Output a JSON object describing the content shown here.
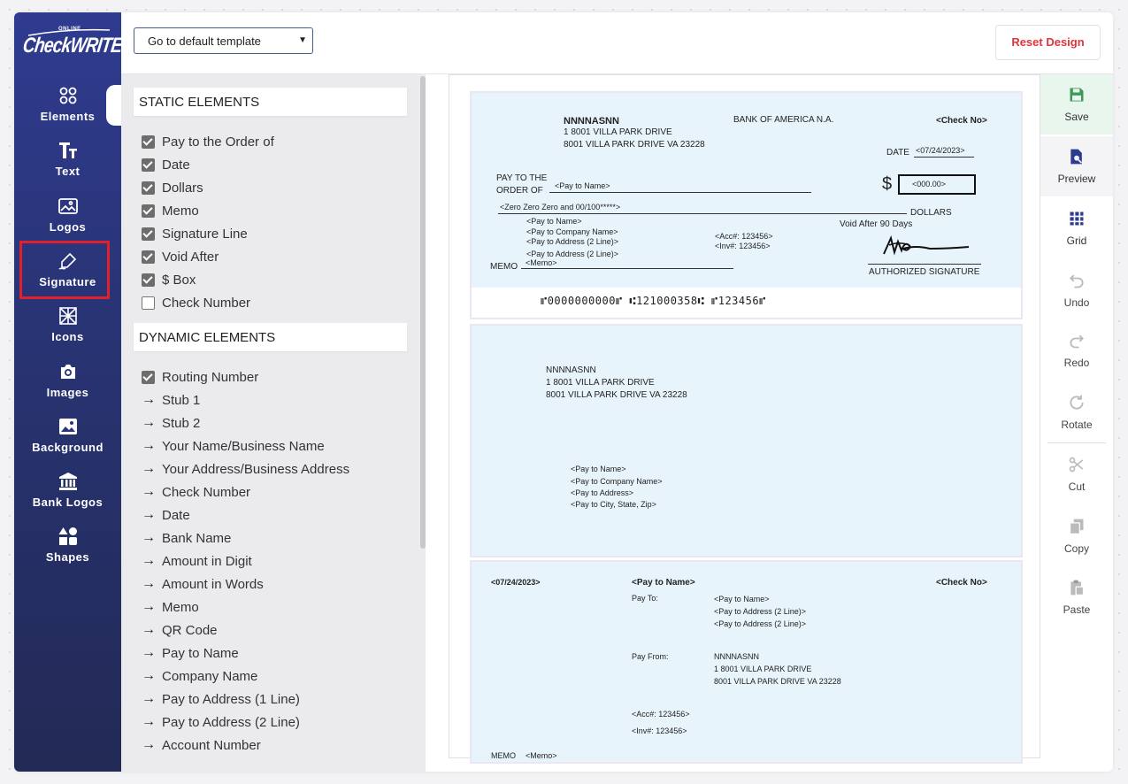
{
  "logo": {
    "small": "ONLINE",
    "big": "CheckWRITER"
  },
  "leftnav": {
    "items": [
      {
        "label": "Elements",
        "icon": "elements-icon"
      },
      {
        "label": "Text",
        "icon": "text-icon"
      },
      {
        "label": "Logos",
        "icon": "logos-icon"
      },
      {
        "label": "Signature",
        "icon": "signature-icon"
      },
      {
        "label": "Icons",
        "icon": "icons-icon"
      },
      {
        "label": "Images",
        "icon": "camera-icon"
      },
      {
        "label": "Background",
        "icon": "image-icon"
      },
      {
        "label": "Bank Logos",
        "icon": "bank-icon"
      },
      {
        "label": "Shapes",
        "icon": "shapes-icon"
      }
    ]
  },
  "header": {
    "template_select": "Go to default template",
    "reset_label": "Reset Design"
  },
  "panel": {
    "static_title": "STATIC ELEMENTS",
    "static_items": [
      {
        "label": "Pay to the Order of",
        "checked": true
      },
      {
        "label": "Date",
        "checked": true
      },
      {
        "label": "Dollars",
        "checked": true
      },
      {
        "label": "Memo",
        "checked": true
      },
      {
        "label": "Signature Line",
        "checked": true
      },
      {
        "label": "Void After",
        "checked": true
      },
      {
        "label": "$ Box",
        "checked": true
      },
      {
        "label": "Check Number",
        "checked": false
      }
    ],
    "dynamic_title": "DYNAMIC ELEMENTS",
    "dynamic_checked": [
      {
        "label": "Routing Number",
        "checked": true
      }
    ],
    "dynamic_items": [
      "Stub 1",
      "Stub 2",
      "Your Name/Business Name",
      "Your Address/Business Address",
      "Check Number",
      "Date",
      "Bank Name",
      "Amount in Digit",
      "Amount in Words",
      "Memo",
      "QR Code",
      "Pay to Name",
      "Company Name",
      "Pay to Address (1 Line)",
      "Pay to Address (2 Line)",
      "Account Number"
    ]
  },
  "check": {
    "name": "NNNNASNN",
    "addr1": "1 8001 VILLA PARK DRIVE",
    "addr2": "8001 VILLA PARK DRIVE VA 23228",
    "bank": "BANK OF AMERICA N.A.",
    "check_no": "<Check No>",
    "date_label": "DATE",
    "date_value": "<07/24/2023>",
    "pay_to_line1": "PAY TO THE",
    "pay_to_line2": "ORDER OF",
    "pay_to_name": "<Pay to Name>",
    "dollar_sign": "$",
    "amount": "<000.00>",
    "amount_words": "<Zero Zero Zero and 00/100*****>",
    "dollars_label": "DOLLARS",
    "payee_lines": [
      "<Pay to Name>",
      "<Pay to Company Name>",
      "<Pay to Address (2 Line)>"
    ],
    "payee_line4": "<Pay to Address (2 Line)>",
    "acc": "<Acc#: 123456>",
    "inv": "<Inv#: 123456>",
    "void_after": "Void After 90 Days",
    "memo_label": "MEMO",
    "memo_value": "<Memo>",
    "auth_sig": "AUTHORIZED SIGNATURE",
    "micr": "⑈0000000000⑈  ⑆121000358⑆  ⑈123456⑈"
  },
  "stub1": {
    "name": "NNNNASNN",
    "addr1": "1 8001 VILLA PARK DRIVE",
    "addr2": "8001 VILLA PARK DRIVE VA 23228",
    "payee": [
      "<Pay to Name>",
      "<Pay to Company Name>",
      "<Pay to Address>",
      "<Pay to City, State, Zip>"
    ]
  },
  "stub2": {
    "date": "<07/24/2023>",
    "pay_to_name": "<Pay to Name>",
    "check_no": "<Check No>",
    "pay_to_label": "Pay To:",
    "pay_to_lines": [
      "<Pay to Name>",
      "<Pay to Address (2 Line)>",
      "<Pay to Address (2 Line)>"
    ],
    "pay_from_label": "Pay From:",
    "pay_from_lines": [
      "NNNNASNN",
      "1 8001 VILLA PARK DRIVE",
      "8001 VILLA PARK DRIVE VA 23228"
    ],
    "acc": "<Acc#: 123456>",
    "inv": "<Inv#: 123456>",
    "memo_label": "MEMO",
    "memo_value": "<Memo>"
  },
  "tools": [
    {
      "label": "Save",
      "icon": "save-icon"
    },
    {
      "label": "Preview",
      "icon": "preview-icon"
    },
    {
      "label": "Grid",
      "icon": "grid-icon"
    },
    {
      "label": "Undo",
      "icon": "undo-icon"
    },
    {
      "label": "Redo",
      "icon": "redo-icon"
    },
    {
      "label": "Rotate",
      "icon": "rotate-icon"
    },
    {
      "label": "Cut",
      "icon": "cut-icon"
    },
    {
      "label": "Copy",
      "icon": "copy-icon"
    },
    {
      "label": "Paste",
      "icon": "paste-icon"
    }
  ],
  "colors": {
    "nav_top": "#2f3b8f",
    "nav_bottom": "#222a55",
    "check_bg": "#e8f4fb",
    "reset": "#e0343c",
    "highlight": "#e0202a"
  }
}
